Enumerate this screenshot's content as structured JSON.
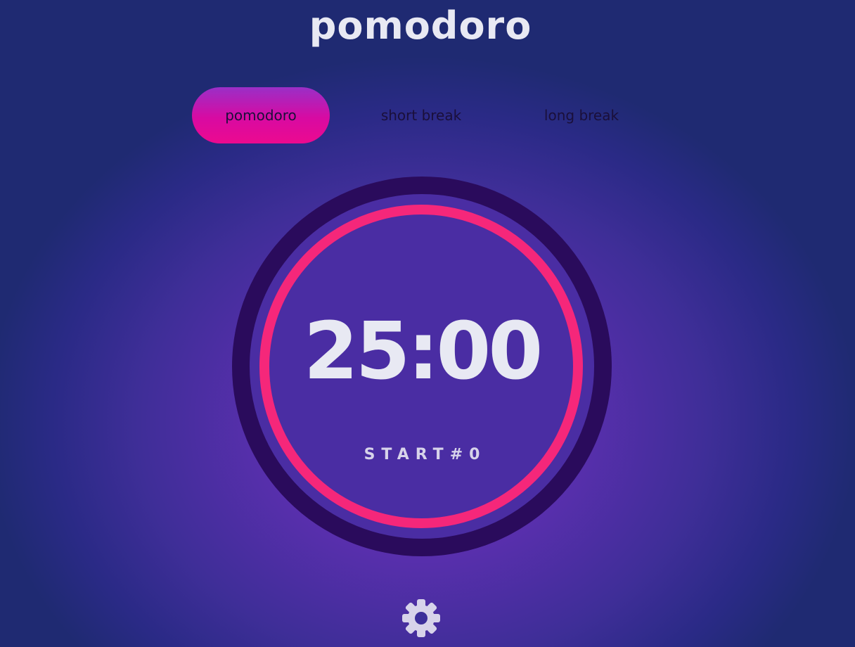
{
  "app": {
    "title": "pomodoro"
  },
  "tabs": [
    {
      "label": "pomodoro",
      "active": true
    },
    {
      "label": "short break",
      "active": false
    },
    {
      "label": "long break",
      "active": false
    }
  ],
  "timer": {
    "time": "25:00",
    "action_label": "START#0",
    "progress": 1.0
  },
  "settings": {
    "icon": "gear-icon"
  },
  "colors": {
    "accent": "#f5277a",
    "tab_active_top": "#9a2fc7",
    "tab_active_bottom": "#ec0a8f",
    "dial_outer": "#2a0b5c",
    "text_light": "#e8e9f3"
  }
}
